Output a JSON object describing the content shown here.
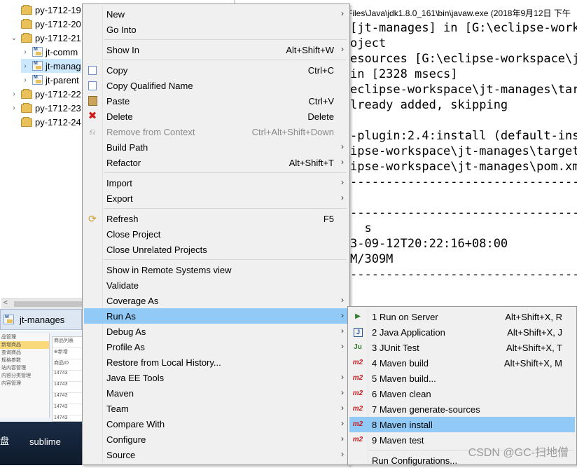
{
  "explorer": {
    "items": [
      {
        "label": "py-1712-19",
        "type": "folder",
        "twisty": ""
      },
      {
        "label": "py-1712-20",
        "type": "folder",
        "twisty": ""
      },
      {
        "label": "py-1712-21",
        "type": "folder",
        "twisty": "expanded"
      },
      {
        "label": "jt-comm",
        "type": "maven",
        "twisty": "collapsed"
      },
      {
        "label": "jt-manag",
        "type": "maven",
        "twisty": "collapsed",
        "selected": true
      },
      {
        "label": "jt-parent",
        "type": "maven",
        "twisty": "collapsed"
      },
      {
        "label": "py-1712-22",
        "type": "folder",
        "twisty": "collapsed"
      },
      {
        "label": "py-1712-23",
        "type": "folder",
        "twisty": "collapsed"
      },
      {
        "label": "py-1712-24",
        "type": "folder",
        "twisty": ""
      }
    ]
  },
  "console": {
    "header": "Files\\Java\\jdk1.8.0_161\\bin\\javaw.exe (2018年9月12日 下午",
    "lines": [
      "[jt-manages] in [G:\\eclipse-work",
      "oject",
      "esources [G:\\eclipse-workspace\\jt",
      "in [2328 msecs]",
      "eclipse-workspace\\jt-manages\\targ",
      "lready added, skipping",
      "",
      "-plugin:2.4:install (default-inst",
      "ipse-workspace\\jt-manages\\target",
      "ipse-workspace\\jt-manages\\pom.xm",
      "--------------------------------",
      "",
      "--------------------------------",
      "  s",
      "3-09-12T20:22:16+08:00",
      "M/309M",
      "--------------------------------"
    ]
  },
  "taskbar": {
    "label": "jt-manages"
  },
  "background_app": {
    "side_items": [
      "品管理",
      "新增商品",
      "查询商品",
      "规格参数",
      "站内容管理",
      "内容分类管理",
      "内容管理"
    ],
    "grid_header": "商品列表",
    "grid_add": "新增",
    "grid_col": "商品ID",
    "grid_rows": [
      "14743",
      "14743",
      "14743",
      "14743",
      "14743"
    ]
  },
  "desktop": {
    "icon_left": "盘",
    "icon_right": "sublime"
  },
  "context_menu": {
    "items": [
      {
        "label": "New",
        "shortcut": "",
        "submenu": true,
        "icon": ""
      },
      {
        "label": "Go Into",
        "shortcut": "",
        "submenu": false,
        "icon": ""
      },
      {
        "sep": true
      },
      {
        "label": "Show In",
        "shortcut": "Alt+Shift+W",
        "submenu": true,
        "icon": ""
      },
      {
        "sep": true
      },
      {
        "label": "Copy",
        "shortcut": "Ctrl+C",
        "submenu": false,
        "icon": "copy-icon"
      },
      {
        "label": "Copy Qualified Name",
        "shortcut": "",
        "submenu": false,
        "icon": "copy-icon"
      },
      {
        "label": "Paste",
        "shortcut": "Ctrl+V",
        "submenu": false,
        "icon": "paste-icon"
      },
      {
        "label": "Delete",
        "shortcut": "Delete",
        "submenu": false,
        "icon": "delete-icon"
      },
      {
        "label": "Remove from Context",
        "shortcut": "Ctrl+Alt+Shift+Down",
        "submenu": false,
        "icon": "remove-icon",
        "disabled": true
      },
      {
        "label": "Build Path",
        "shortcut": "",
        "submenu": true,
        "icon": ""
      },
      {
        "label": "Refactor",
        "shortcut": "Alt+Shift+T",
        "submenu": true,
        "icon": ""
      },
      {
        "sep": true
      },
      {
        "label": "Import",
        "shortcut": "",
        "submenu": true,
        "icon": ""
      },
      {
        "label": "Export",
        "shortcut": "",
        "submenu": true,
        "icon": ""
      },
      {
        "sep": true
      },
      {
        "label": "Refresh",
        "shortcut": "F5",
        "submenu": false,
        "icon": "refresh-icon"
      },
      {
        "label": "Close Project",
        "shortcut": "",
        "submenu": false,
        "icon": ""
      },
      {
        "label": "Close Unrelated Projects",
        "shortcut": "",
        "submenu": false,
        "icon": ""
      },
      {
        "sep": true
      },
      {
        "label": "Show in Remote Systems view",
        "shortcut": "",
        "submenu": false,
        "icon": ""
      },
      {
        "label": "Validate",
        "shortcut": "",
        "submenu": false,
        "icon": ""
      },
      {
        "label": "Coverage As",
        "shortcut": "",
        "submenu": true,
        "icon": ""
      },
      {
        "label": "Run As",
        "shortcut": "",
        "submenu": true,
        "icon": "",
        "highlighted": true
      },
      {
        "label": "Debug As",
        "shortcut": "",
        "submenu": true,
        "icon": ""
      },
      {
        "label": "Profile As",
        "shortcut": "",
        "submenu": true,
        "icon": ""
      },
      {
        "label": "Restore from Local History...",
        "shortcut": "",
        "submenu": false,
        "icon": ""
      },
      {
        "label": "Java EE Tools",
        "shortcut": "",
        "submenu": true,
        "icon": ""
      },
      {
        "label": "Maven",
        "shortcut": "",
        "submenu": true,
        "icon": ""
      },
      {
        "label": "Team",
        "shortcut": "",
        "submenu": true,
        "icon": ""
      },
      {
        "label": "Compare With",
        "shortcut": "",
        "submenu": true,
        "icon": ""
      },
      {
        "label": "Configure",
        "shortcut": "",
        "submenu": true,
        "icon": ""
      },
      {
        "label": "Source",
        "shortcut": "",
        "submenu": true,
        "icon": ""
      }
    ]
  },
  "run_as_menu": {
    "items": [
      {
        "label": "1 Run on Server",
        "shortcut": "Alt+Shift+X, R",
        "icon": "server-icon",
        "glyph": "▶"
      },
      {
        "label": "2 Java Application",
        "shortcut": "Alt+Shift+X, J",
        "icon": "java-icon",
        "glyph": "J"
      },
      {
        "label": "3 JUnit Test",
        "shortcut": "Alt+Shift+X, T",
        "icon": "junit-icon",
        "glyph": "Ju"
      },
      {
        "label": "4 Maven build",
        "shortcut": "Alt+Shift+X, M",
        "icon": "maven-icon",
        "glyph": "m2"
      },
      {
        "label": "5 Maven build...",
        "shortcut": "",
        "icon": "maven-icon",
        "glyph": "m2"
      },
      {
        "label": "6 Maven clean",
        "shortcut": "",
        "icon": "maven-icon",
        "glyph": "m2"
      },
      {
        "label": "7 Maven generate-sources",
        "shortcut": "",
        "icon": "maven-icon",
        "glyph": "m2"
      },
      {
        "label": "8 Maven install",
        "shortcut": "",
        "icon": "maven-icon",
        "glyph": "m2",
        "highlighted": true
      },
      {
        "label": "9 Maven test",
        "shortcut": "",
        "icon": "maven-icon",
        "glyph": "m2"
      },
      {
        "sep": true
      },
      {
        "label": "Run Configurations...",
        "shortcut": "",
        "icon": "",
        "glyph": ""
      }
    ]
  },
  "watermark": "CSDN @GC-扫地僧"
}
